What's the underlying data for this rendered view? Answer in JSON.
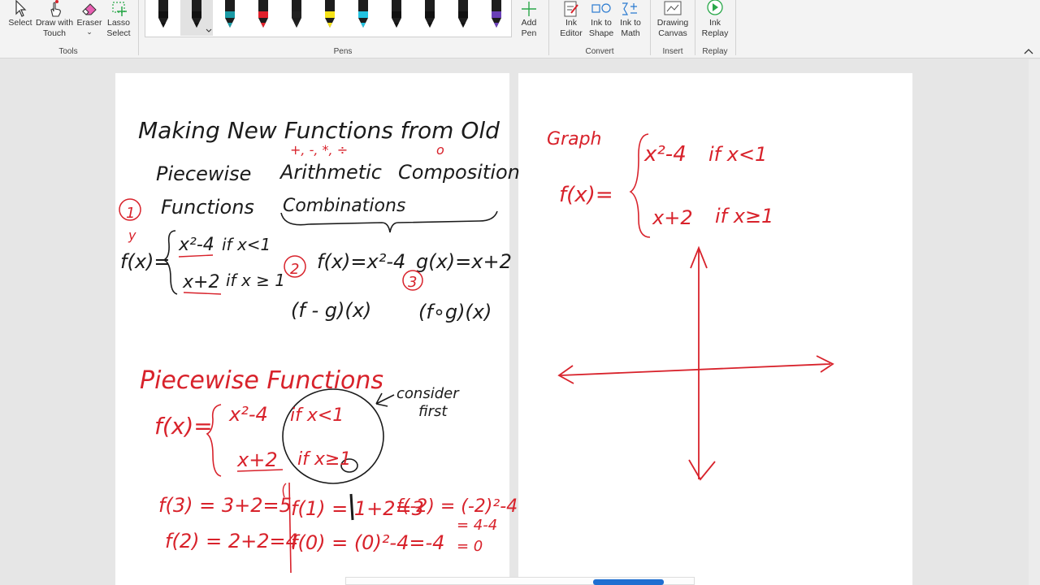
{
  "ribbon": {
    "tools": {
      "group_label": "Tools",
      "select_label": "Select",
      "draw_with_touch_label": "Draw with Touch",
      "eraser_label": "Eraser",
      "eraser_caret": "⌄",
      "lasso_select_label": "Lasso Select"
    },
    "pens": {
      "group_label": "Pens",
      "items": [
        {
          "name": "black-pen-1",
          "color": "#111111"
        },
        {
          "name": "black-pen-selected",
          "color": "#111111"
        },
        {
          "name": "teal-pen",
          "color": "#1a9aa5"
        },
        {
          "name": "red-pen",
          "color": "#e0202a"
        },
        {
          "name": "galaxy-pen",
          "color": "#222222"
        },
        {
          "name": "yellow-highlighter",
          "color": "#f5e218"
        },
        {
          "name": "cyan-pen",
          "color": "#24c2e0"
        },
        {
          "name": "black-galaxy-pen",
          "color": "#111111"
        },
        {
          "name": "black-pen-2",
          "color": "#111111"
        },
        {
          "name": "black-pen-3",
          "color": "#111111"
        },
        {
          "name": "purple-pen",
          "color": "#6a3fb7"
        }
      ],
      "add_pen_label": "Add Pen"
    },
    "convert": {
      "group_label": "Convert",
      "ink_editor_label": "Ink Editor",
      "ink_to_shape_label": "Ink to Shape",
      "ink_to_math_label": "Ink to Math"
    },
    "insert": {
      "group_label": "Insert",
      "drawing_canvas_label": "Drawing Canvas"
    },
    "replay": {
      "group_label": "Replay",
      "ink_replay_label": "Ink Replay"
    }
  },
  "colors": {
    "ink_black": "#1b1b1b",
    "ink_red": "#d8222b",
    "accent_blue": "#1f6fd1"
  },
  "left_page": {
    "title": "Making New Functions from Old",
    "col_piecewise": "Piecewise",
    "col_functions": "Functions",
    "col_arithmetic": "Arithmetic",
    "col_combinations": "Combinations",
    "col_composition": "Composition",
    "ops_annot": "+, -, *, ÷",
    "compose_annot": "o",
    "num1": "1",
    "num2": "2",
    "num3": "3",
    "y_annot": "y",
    "ex1_fx": "f(x)=",
    "ex1_case1": "x²-4",
    "ex1_cond1": "if x<1",
    "ex1_case2": "x+2",
    "ex1_cond2": "if x ≥ 1",
    "ex2_fx": "f(x)=x²-4",
    "ex2_gx": "g(x)=x+2",
    "ex2_fminusg": "(f - g)(x)",
    "ex3_fog": "(f∘g)(x)",
    "pw_heading": "Piecewise Functions",
    "pw_fx": "f(x)=",
    "pw_case1": "x²-4",
    "pw_cond1": "if x<1",
    "pw_case2": "x+2",
    "pw_cond2": "if x≥1",
    "consider": "consider",
    "first": "first",
    "eval_f3": "f(3) = 3+2=5",
    "eval_f2": "f(2) = 2+2=4",
    "eval_f1": "f(1) = 1+2=3",
    "eval_f0": "f(0) = (0)²-4=-4",
    "eval_fm2": "f(-2) = (-2)²-4",
    "eval_fm2_b": "= 4-4",
    "eval_fm2_c": "= 0"
  },
  "right_page": {
    "graph_label": "Graph",
    "fx": "f(x)=",
    "case1": "x²-4",
    "cond1": "if x<1",
    "case2": "x+2",
    "cond2": "if x≥1"
  }
}
